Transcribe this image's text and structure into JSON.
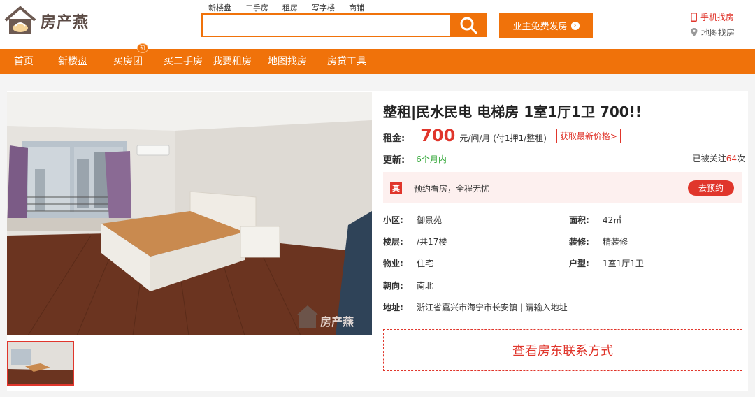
{
  "brand": {
    "name": "房产燕",
    "watermark": "房产燕"
  },
  "search": {
    "tabs": [
      "新楼盘",
      "二手房",
      "租房",
      "写字楼",
      "商铺"
    ],
    "placeholder": ""
  },
  "header": {
    "publish_label": "业主免费发房",
    "mobile_link": "手机找房",
    "map_link": "地图找房"
  },
  "nav": {
    "items": [
      "首页",
      "新楼盘",
      "买房团",
      "买二手房",
      "我要租房",
      "地图找房",
      "房贷工具"
    ],
    "hot_badge": "热"
  },
  "listing": {
    "title": "整租|民水民电 电梯房 1室1厅1卫 700!!",
    "rent_label": "租金:",
    "rent_value": "700",
    "rent_unit": "元/间/月 (付1押1/整租)",
    "latest_price_link": "获取最新价格>",
    "update_label": "更新:",
    "update_value": "6个月内",
    "follow_prefix": "已被关注",
    "follow_count": "64",
    "follow_suffix": "次",
    "verify_icon": "真",
    "verify_text": "预约看房，全程无忧",
    "reserve_label": "去预约",
    "details": {
      "community_label": "小区:",
      "community": "御景苑",
      "area_label": "面积:",
      "area": "42㎡",
      "floor_label": "楼层:",
      "floor": "/共17楼",
      "decoration_label": "装修:",
      "decoration": "精装修",
      "property_label": "物业:",
      "property": "住宅",
      "layout_label": "户型:",
      "layout": "1室1厅1卫",
      "orientation_label": "朝向:",
      "orientation": "南北",
      "address_label": "地址:",
      "address": "浙江省嘉兴市海宁市长安镇 | 请输入地址"
    },
    "contact_label": "查看房东联系方式"
  },
  "colors": {
    "accent": "#f0720a",
    "red": "#e0362c",
    "green": "#35a83a"
  }
}
